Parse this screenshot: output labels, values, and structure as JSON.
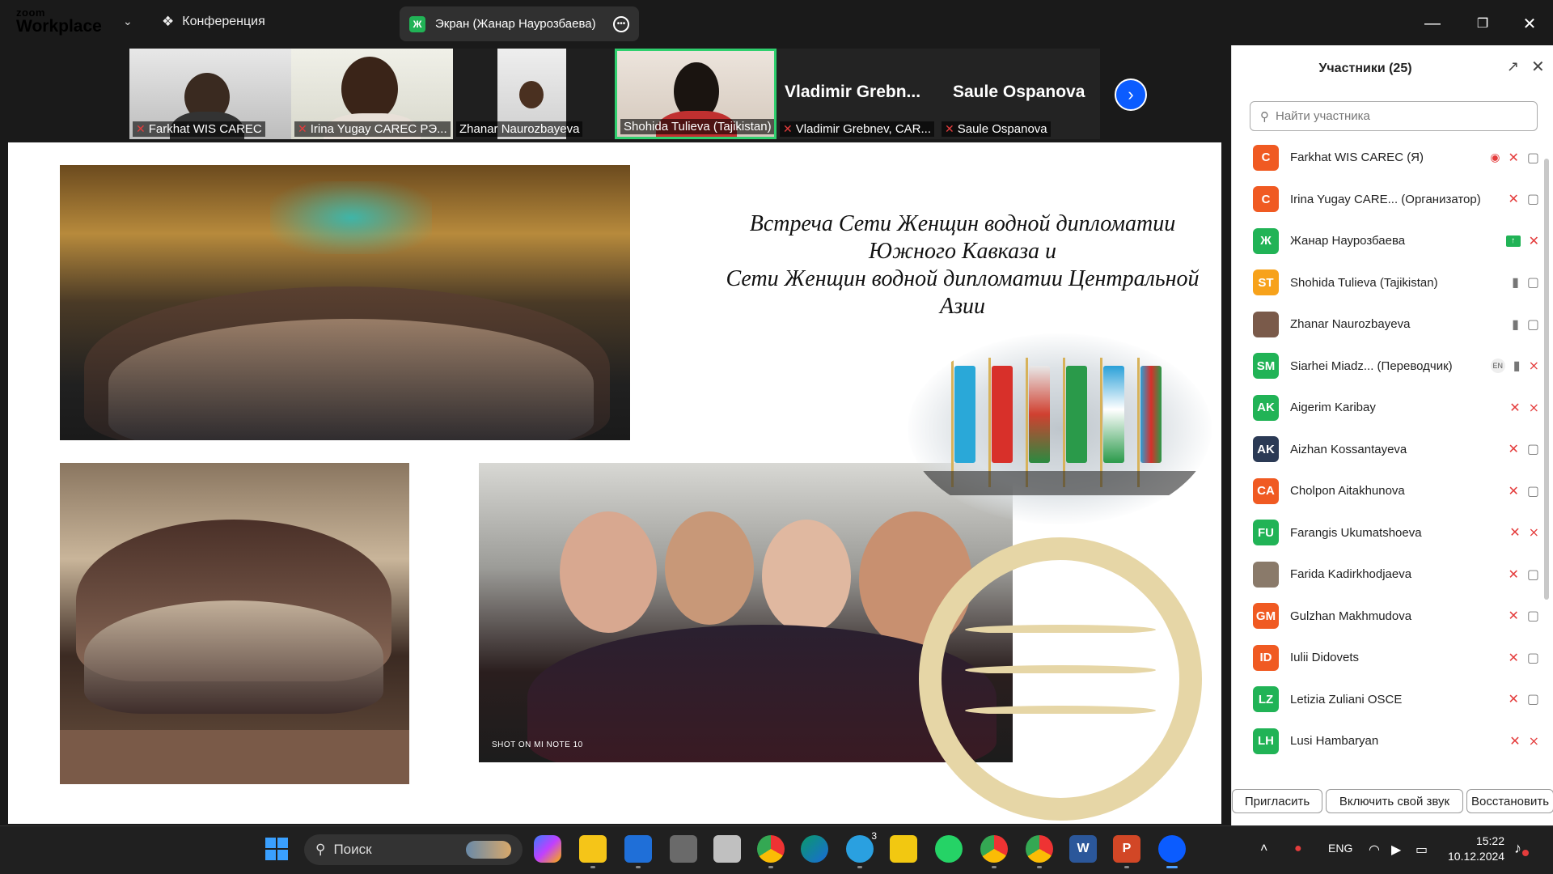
{
  "app": {
    "logo_line1": "zoom",
    "logo_line2": "Workplace",
    "conference_label": "Конференция",
    "share_label": "Экран (Жанар Наурозбаева)",
    "share_avatar": "Ж"
  },
  "thumbnails": [
    {
      "name": "Farkhat WIS CAREC",
      "muted": true,
      "active": false,
      "big_name": ""
    },
    {
      "name": "Irina Yugay CAREC РЭ...",
      "muted": true,
      "active": false,
      "big_name": ""
    },
    {
      "name": "Zhanar Naurozbayeva",
      "muted": false,
      "active": false,
      "big_name": ""
    },
    {
      "name": "Shohida Tulieva (Tajikistan)",
      "muted": false,
      "active": true,
      "big_name": ""
    },
    {
      "name": "Vladimir Grebnev, CAR...",
      "muted": true,
      "active": false,
      "big_name": "Vladimir  Grebn..."
    },
    {
      "name": "Saule Ospanova",
      "muted": true,
      "active": false,
      "big_name": "Saule Ospanova"
    }
  ],
  "slide": {
    "title_lines": [
      "Встреча Сети Женщин водной дипломатии",
      "Южного Кавказа и",
      "Сети Женщин водной дипломатии Центральной",
      "Азии"
    ],
    "photo_stamp": "SHOT ON MI NOTE 10"
  },
  "panel": {
    "title": "Участники (25)",
    "search_placeholder": "Найти участника",
    "participants": [
      {
        "initials": "C",
        "color": "#f05a22",
        "name": "Farkhat WIS CAREC (Я)",
        "rec": true,
        "share": false,
        "en": false,
        "mic": "off",
        "cam": "on"
      },
      {
        "initials": "C",
        "color": "#f05a22",
        "name": "Irina Yugay CARE... (Организатор)",
        "rec": false,
        "share": false,
        "en": false,
        "mic": "off",
        "cam": "on"
      },
      {
        "initials": "Ж",
        "color": "#21b356",
        "name": "Жанар Наурозбаева",
        "rec": false,
        "share": true,
        "en": false,
        "mic": "off",
        "cam": "none"
      },
      {
        "initials": "ST",
        "color": "#f7a21b",
        "name": "Shohida Tulieva (Tajikistan)",
        "rec": false,
        "share": false,
        "en": false,
        "mic": "on",
        "cam": "on"
      },
      {
        "initials": "",
        "color": "#7a5a4a",
        "name": "Zhanar Naurozbayeva",
        "rec": false,
        "share": false,
        "en": false,
        "mic": "on",
        "cam": "on"
      },
      {
        "initials": "SM",
        "color": "#21b356",
        "name": "Siarhei Miadz... (Переводчик)",
        "rec": false,
        "share": false,
        "en": true,
        "mic": "on",
        "cam": "off"
      },
      {
        "initials": "AK",
        "color": "#21b356",
        "name": "Aigerim Karibay",
        "rec": false,
        "share": false,
        "en": false,
        "mic": "off",
        "cam": "off"
      },
      {
        "initials": "AK",
        "color": "#2b3a55",
        "name": "Aizhan Kossantayeva",
        "rec": false,
        "share": false,
        "en": false,
        "mic": "off",
        "cam": "on"
      },
      {
        "initials": "CA",
        "color": "#f05a22",
        "name": "Cholpon Aitakhunova",
        "rec": false,
        "share": false,
        "en": false,
        "mic": "off",
        "cam": "on"
      },
      {
        "initials": "FU",
        "color": "#21b356",
        "name": "Farangis Ukumatshoeva",
        "rec": false,
        "share": false,
        "en": false,
        "mic": "off",
        "cam": "off"
      },
      {
        "initials": "",
        "color": "#8a7a6a",
        "name": "Farida Kadirkhodjaeva",
        "rec": false,
        "share": false,
        "en": false,
        "mic": "off",
        "cam": "on"
      },
      {
        "initials": "GM",
        "color": "#f05a22",
        "name": "Gulzhan Makhmudova",
        "rec": false,
        "share": false,
        "en": false,
        "mic": "off",
        "cam": "on"
      },
      {
        "initials": "ID",
        "color": "#f05a22",
        "name": "Iulii Didovets",
        "rec": false,
        "share": false,
        "en": false,
        "mic": "off",
        "cam": "on"
      },
      {
        "initials": "LZ",
        "color": "#21b356",
        "name": "Letizia Zuliani OSCE",
        "rec": false,
        "share": false,
        "en": false,
        "mic": "off",
        "cam": "on"
      },
      {
        "initials": "LH",
        "color": "#21b356",
        "name": "Lusi Hambaryan",
        "rec": false,
        "share": false,
        "en": false,
        "mic": "off",
        "cam": "off"
      }
    ],
    "buttons": [
      "Пригласить",
      "Включить свой звук",
      "Восстановить"
    ]
  },
  "taskbar": {
    "search_label": "Поиск",
    "language": "ENG",
    "time": "15:22",
    "date": "10.12.2024",
    "telegram_badge": "3"
  }
}
